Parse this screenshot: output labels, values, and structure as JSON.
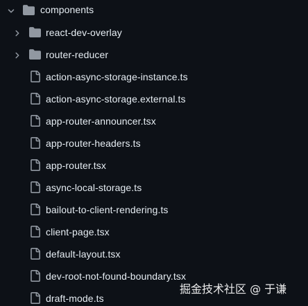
{
  "colors": {
    "background": "#0d1117",
    "text": "#e6edf3",
    "icon": "#9198a1"
  },
  "tree": {
    "root": {
      "label": "components",
      "expanded": true,
      "icon": "folder-icon"
    },
    "children": [
      {
        "label": "react-dev-overlay",
        "type": "folder",
        "expanded": false
      },
      {
        "label": "router-reducer",
        "type": "folder",
        "expanded": false
      },
      {
        "label": "action-async-storage-instance.ts",
        "type": "file"
      },
      {
        "label": "action-async-storage.external.ts",
        "type": "file"
      },
      {
        "label": "app-router-announcer.tsx",
        "type": "file"
      },
      {
        "label": "app-router-headers.ts",
        "type": "file"
      },
      {
        "label": "app-router.tsx",
        "type": "file"
      },
      {
        "label": "async-local-storage.ts",
        "type": "file"
      },
      {
        "label": "bailout-to-client-rendering.ts",
        "type": "file"
      },
      {
        "label": "client-page.tsx",
        "type": "file"
      },
      {
        "label": "default-layout.tsx",
        "type": "file"
      },
      {
        "label": "dev-root-not-found-boundary.tsx",
        "type": "file"
      },
      {
        "label": "draft-mode.ts",
        "type": "file"
      }
    ]
  },
  "watermark": {
    "text": "掘金技术社区 @ 于谦"
  }
}
